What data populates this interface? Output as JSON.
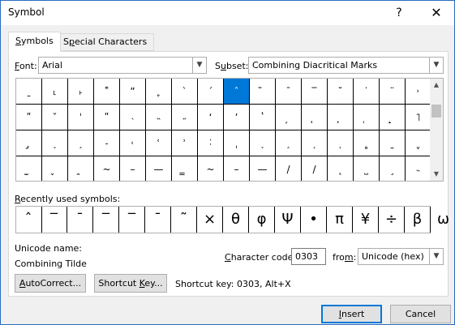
{
  "window": {
    "title": "Symbol",
    "help": "?",
    "close": "✕"
  },
  "tabs": [
    {
      "label": "Symbols",
      "accel": "S",
      "rest": "ymbols"
    },
    {
      "label": "Special Characters",
      "pre": "S",
      "accel": "p",
      "rest": "ecial Characters"
    }
  ],
  "font": {
    "label": "Font:",
    "accel": "F",
    "rest": "ont:",
    "value": "Arial"
  },
  "subset": {
    "label": "Subset:",
    "accel": "u",
    "pre": "S",
    "rest": "bset:",
    "value": "Combining Diacritical Marks"
  },
  "grid_rows": [
    [
      "ˍ",
      "˪",
      "˫",
      "˭",
      "ˮ",
      "˿",
      "ˋ",
      "ˊ",
      "ˆ",
      "̃",
      "ˉ",
      "‾",
      "˘",
      "˙",
      "¨",
      "˒"
    ],
    [
      "ʺ",
      "ˇ",
      "ˈ",
      "ʺ",
      "˴",
      "˵",
      "˶",
      "ʻ",
      "ʼ",
      "ʽ",
      "̗",
      "̘",
      "̙",
      "̜",
      "̝",
      "˥"
    ],
    [
      "̡",
      "˰",
      "˰",
      "˗",
      "˓",
      "ʿ",
      "ʾ",
      "˸",
      "ˌ",
      "˯",
      "˰",
      "˱",
      "˲",
      "˳",
      "˷",
      "ˬ"
    ],
    [
      "̫",
      "̬",
      "̯",
      "~",
      "–",
      "—",
      "̳",
      "~",
      "–",
      "—",
      "/",
      "/",
      "˛",
      "˽",
      "˼",
      "˵"
    ]
  ],
  "selected_cell": {
    "row": 0,
    "col": 8
  },
  "recently_used": {
    "label": "Recently used symbols:",
    "accel": "R",
    "rest": "ecently used symbols:",
    "symbols": [
      "ˆ",
      "‾",
      "ˉ",
      "‾",
      "‾",
      "ˉ",
      "˜",
      "×",
      "θ",
      "φ",
      "Ψ",
      "•",
      "π",
      "¥",
      "÷",
      "β",
      "ω"
    ]
  },
  "unicode_name": {
    "label": "Unicode name:",
    "value": "Combining Tilde"
  },
  "char_code": {
    "label": "Character code:",
    "accel": "C",
    "rest": "haracter code:",
    "value": "0303"
  },
  "from": {
    "label": "from:",
    "accel": "m",
    "pre": "fro",
    "rest": ":",
    "value": "Unicode (hex)"
  },
  "buttons": {
    "autocorrect": {
      "accel": "A",
      "rest": "utoCorrect..."
    },
    "shortcut_key": {
      "pre": "Shortcut ",
      "accel": "K",
      "rest": "ey..."
    },
    "insert": {
      "accel": "I",
      "rest": "nsert"
    },
    "cancel": "Cancel"
  },
  "shortcut_text": "Shortcut key: 0303, Alt+X",
  "colors": {
    "accent": "#0078d7",
    "title_bg": "#ffffff",
    "dialog_bg": "#f0f0f0"
  }
}
